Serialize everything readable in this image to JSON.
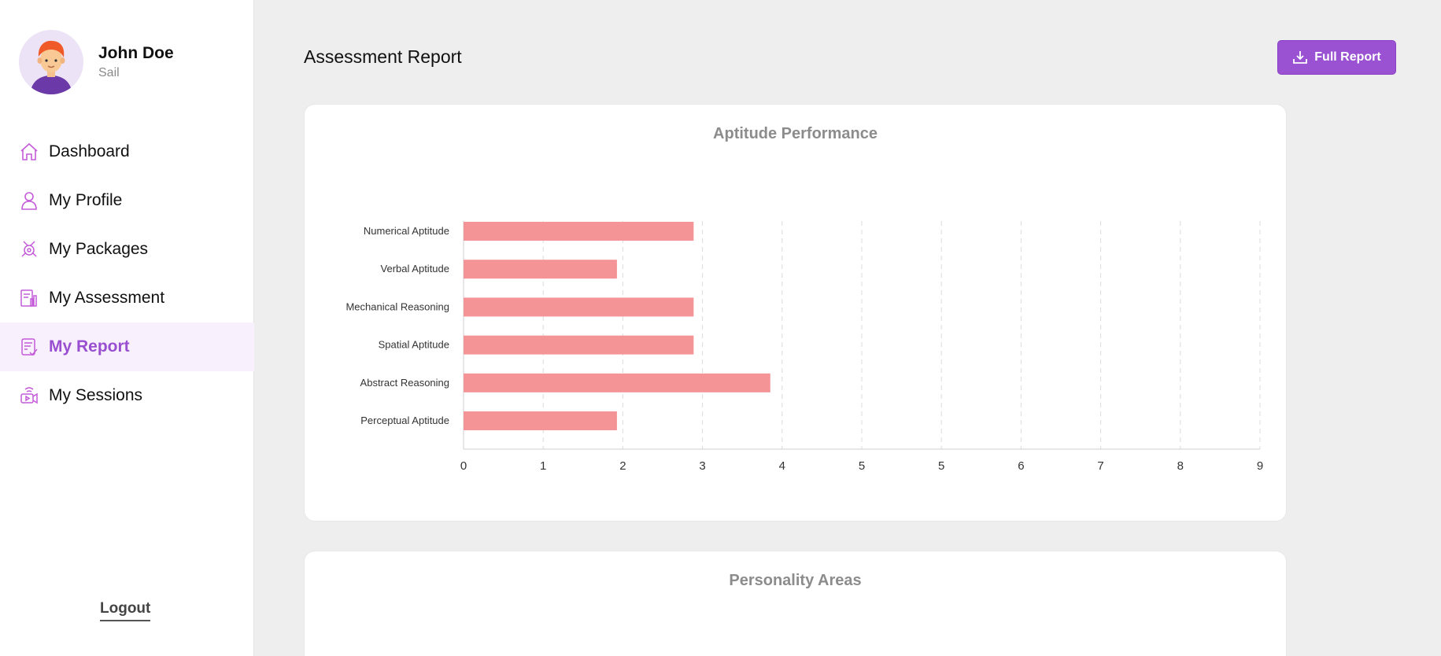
{
  "user": {
    "name": "John Doe",
    "subtitle": "Sail"
  },
  "nav": {
    "items": [
      {
        "label": "Dashboard",
        "icon": "home-icon"
      },
      {
        "label": "My Profile",
        "icon": "user-icon"
      },
      {
        "label": "My Packages",
        "icon": "packages-icon"
      },
      {
        "label": "My Assessment",
        "icon": "assessment-icon"
      },
      {
        "label": "My Report",
        "icon": "report-icon",
        "active": true
      },
      {
        "label": "My Sessions",
        "icon": "sessions-icon"
      }
    ],
    "logout": "Logout"
  },
  "header": {
    "title": "Assessment Report",
    "full_report_label": "Full Report"
  },
  "colors": {
    "accent": "#9a52d2",
    "bar": "#f49496",
    "active_bg": "#f8f1fd"
  },
  "aptitude": {
    "title": "Aptitude Performance",
    "chart_data": {
      "type": "bar",
      "orientation": "horizontal",
      "categories": [
        "Numerical Aptitude",
        "Verbal Aptitude",
        "Mechanical Reasoning",
        "Spatial Aptitude",
        "Abstract Reasoning",
        "Perceptual Aptitude"
      ],
      "values": [
        3.33,
        2.22,
        3.33,
        3.33,
        4.44,
        2.22
      ],
      "x_tick_labels": [
        "0",
        "1",
        "2",
        "3",
        "4",
        "5",
        "5",
        "6",
        "7",
        "8",
        "9"
      ],
      "xlim": [
        0,
        10
      ],
      "grid": "vertical-dashed"
    }
  },
  "personality": {
    "title": "Personality Areas"
  }
}
